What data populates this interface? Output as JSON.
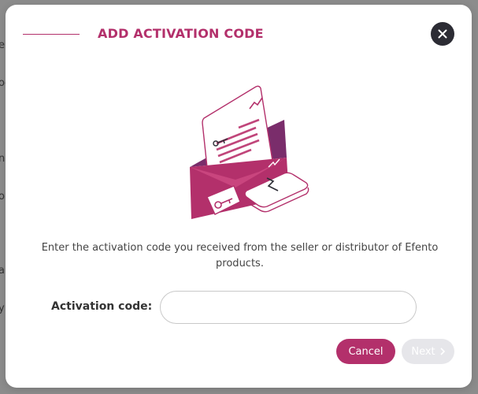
{
  "dialog": {
    "title": "ADD ACTIVATION CODE",
    "description": "Enter the activation code you received from the seller or distributor of Efento products.",
    "field_label": "Activation code:",
    "field_value": "",
    "field_placeholder": "",
    "cancel_label": "Cancel",
    "next_label": "Next",
    "close_icon": "close-icon",
    "next_icon": "chevron-right-icon"
  },
  "backdrop": {
    "fragments": [
      "er",
      "og",
      "n",
      "ol",
      "a",
      "y"
    ]
  },
  "colors": {
    "accent": "#b3306b",
    "close_bg": "#2c2c34",
    "next_disabled_bg": "#e6e6ea",
    "overlay": "#8c8c8c"
  }
}
